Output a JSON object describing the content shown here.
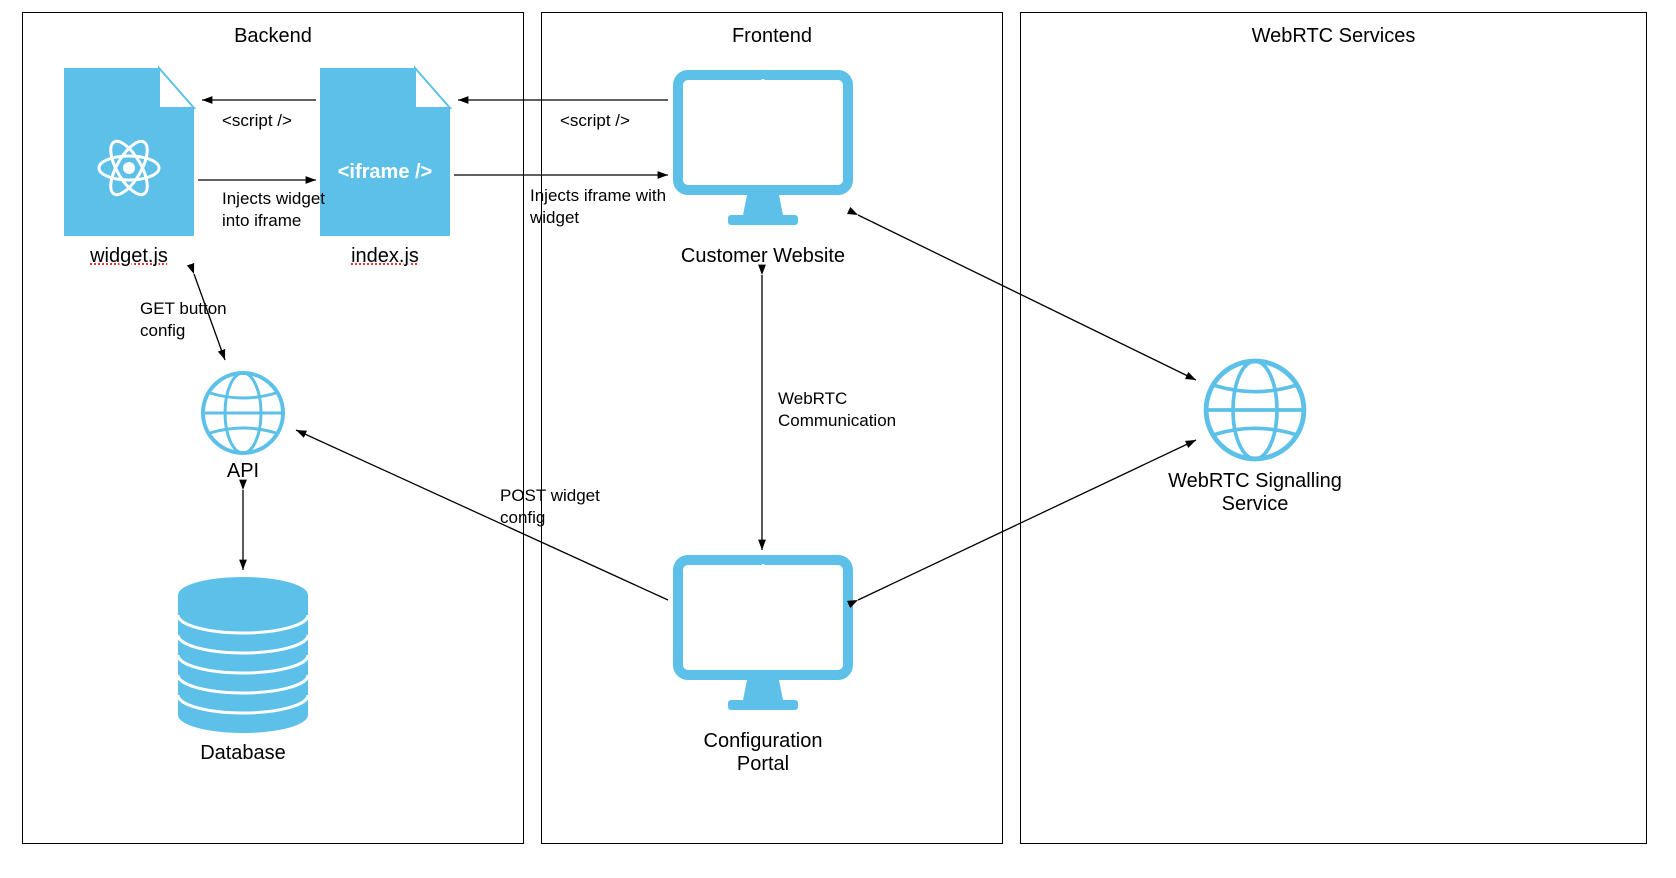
{
  "containers": {
    "backend": {
      "title": "Backend"
    },
    "frontend": {
      "title": "Frontend"
    },
    "webrtc": {
      "title": "WebRTC Services"
    }
  },
  "nodes": {
    "widget_js": {
      "label": "widget.js"
    },
    "index_js": {
      "label": "index.js",
      "iframe_text": "<iframe />"
    },
    "api": {
      "label": "API"
    },
    "database": {
      "label": "Database"
    },
    "customer_website": {
      "label": "Customer Website"
    },
    "config_portal": {
      "label": "Configuration\nPortal"
    },
    "signalling": {
      "label": "WebRTC Signalling Service"
    }
  },
  "edges": {
    "script1": "<script />",
    "script2": "<script />",
    "injects_iframe": "Injects widget\ninto iframe",
    "injects_widget": "Injects iframe with\nwidget",
    "get_button": "GET button\nconfig",
    "post_widget": "POST widget\nconfig",
    "webrtc_comm": "WebRTC\nCommunication"
  }
}
